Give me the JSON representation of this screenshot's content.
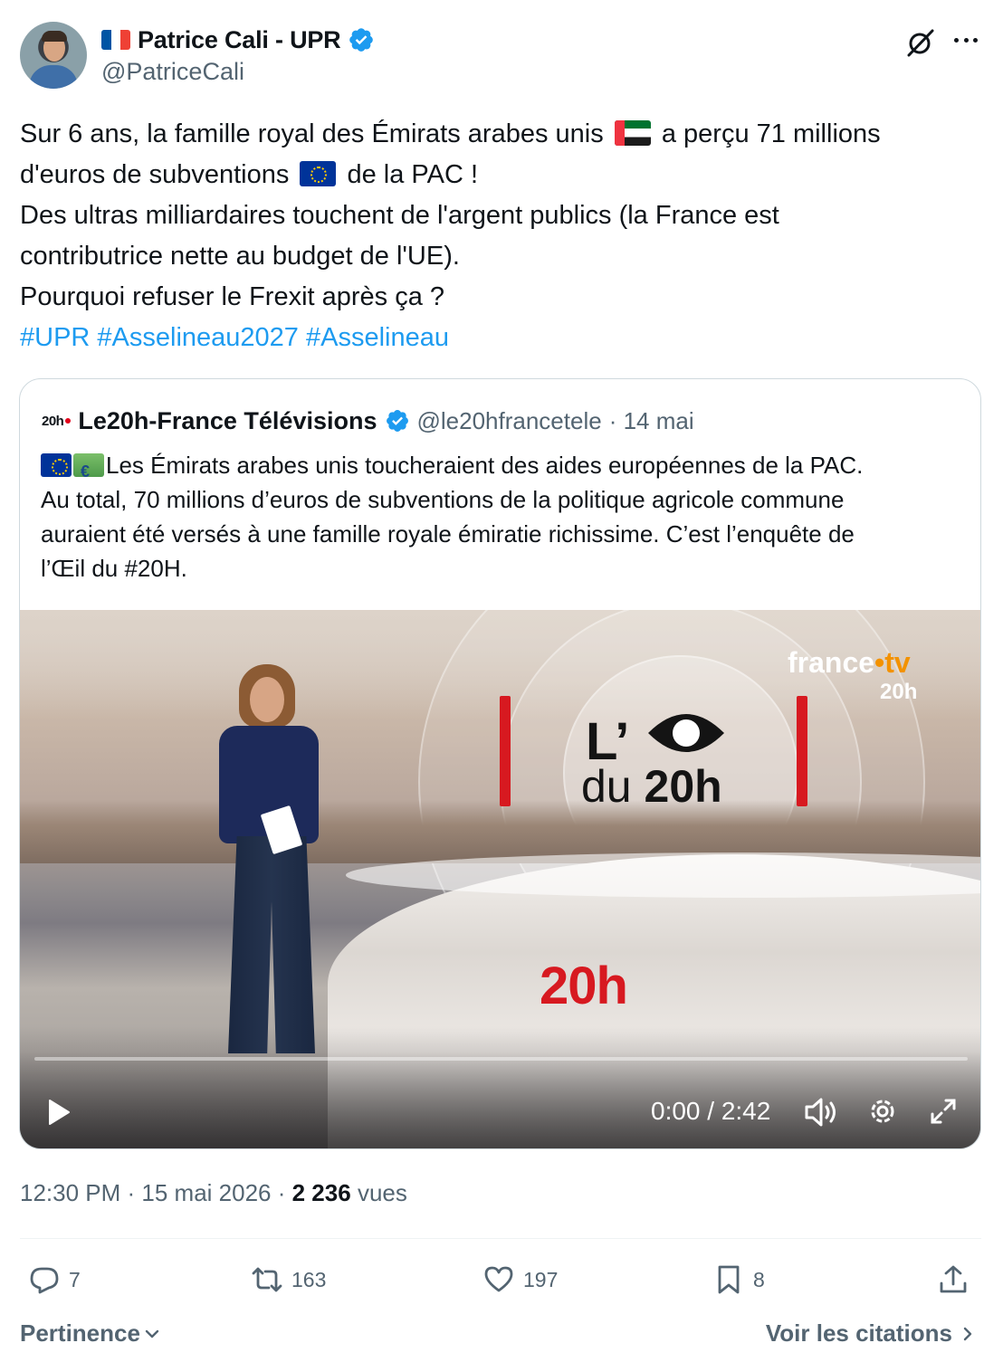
{
  "author": {
    "name": "Patrice Cali - UPR",
    "handle": "@PatriceCali"
  },
  "tweet": {
    "lines": [
      {
        "before": "Sur 6 ans, la famille royal des Émirats arabes unis",
        "after": "a perçu 71 millions"
      },
      {
        "before": "d'euros de subventions",
        "after": "de la PAC !"
      },
      "Des ultras milliardaires touchent de l'argent publics (la France est",
      "contributrice nette au budget de l'UE).",
      "Pourquoi refuser le Frexit après ça ?"
    ],
    "hashtags": "#UPR #Asselineau2027 #Asselineau"
  },
  "quote": {
    "logo": "20h",
    "name": "Le20h-France Télévisions",
    "handle": "@le20hfrancetele",
    "date": "· 14 mai",
    "lines": [
      "Les Émirats arabes unis toucheraient des aides européennes de la PAC.",
      "Au total, 70 millions d’euros de subventions de la politique agricole commune",
      "auraient été versés à une famille royale émiratie richissime. C’est l’enquête de",
      "l’Œil du #20H."
    ],
    "video": {
      "brand": "france",
      "brand_tv": "tv",
      "brand_20h": "20h",
      "title_l": "L’",
      "title_du": "du",
      "title_20h": "20h",
      "desk_label": "20h",
      "time": "0:00 / 2:42",
      "progress": 0
    }
  },
  "meta": {
    "time_date": "12:30 PM · 15 mai 2026 ·",
    "views_count": "2 236",
    "views_label": "vues"
  },
  "actions": {
    "replies": "7",
    "reposts": "163",
    "likes": "197",
    "bookmarks": "8"
  },
  "footer": {
    "sort": "Pertinence",
    "quotes_link": "Voir les citations"
  },
  "colors": {
    "accent": "#1d9bf0",
    "muted": "#536471",
    "verified": "#1d9bf0",
    "brand_red": "#d71920"
  }
}
